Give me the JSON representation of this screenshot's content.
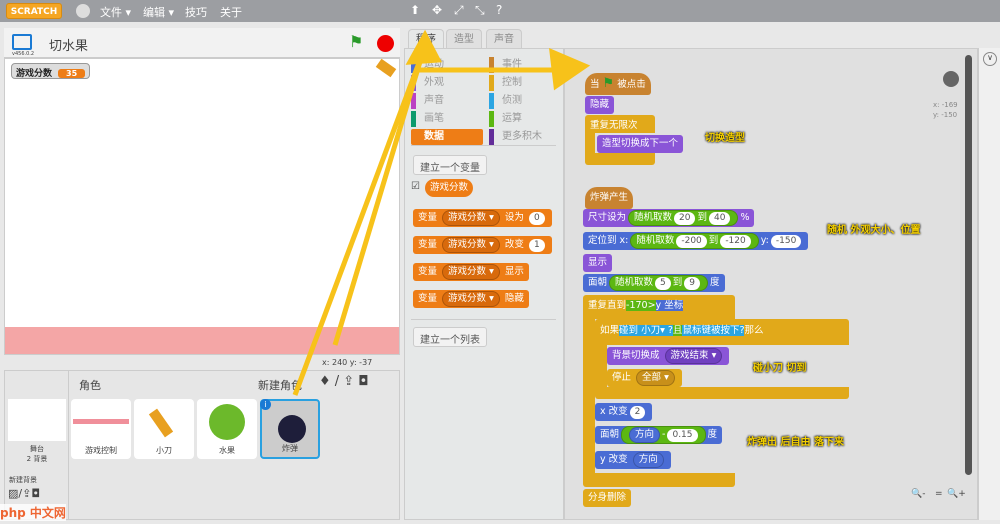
{
  "topbar": {
    "logo": "SCRATCH",
    "menus": [
      "文件 ▾",
      "编辑 ▾",
      "技巧",
      "关于"
    ],
    "tools": [
      "⬆",
      "✥",
      "⤢",
      "⤡",
      "?"
    ]
  },
  "stage": {
    "title": "切水果",
    "version": "v456.0.2",
    "monitor_label": "游戏分数",
    "monitor_value": "35",
    "coords": "x: 240  y: -37"
  },
  "sprites": {
    "header": "角色",
    "new_sprite": "新建角色",
    "stage_label": "舞台",
    "stage_sub": "2 背景",
    "new_backdrop": "新建背景",
    "items": [
      {
        "name": "游戏控制"
      },
      {
        "name": "小刀"
      },
      {
        "name": "水果"
      },
      {
        "name": "炸弹",
        "selected": true
      }
    ]
  },
  "tabs": [
    "程序",
    "造型",
    "声音"
  ],
  "palette": {
    "categories": [
      {
        "label": "运动",
        "color": "#4a6cd4"
      },
      {
        "label": "事件",
        "color": "#c88330"
      },
      {
        "label": "外观",
        "color": "#8a55d7"
      },
      {
        "label": "控制",
        "color": "#e1a91a"
      },
      {
        "label": "声音",
        "color": "#bb42c3"
      },
      {
        "label": "侦测",
        "color": "#2ca5e2"
      },
      {
        "label": "画笔",
        "color": "#0e9a6c"
      },
      {
        "label": "运算",
        "color": "#5cb712"
      },
      {
        "label": "数据",
        "color": "#ee7d16"
      },
      {
        "label": "更多积木",
        "color": "#632d99"
      }
    ],
    "make_variable": "建立一个变量",
    "variable": "游戏分数",
    "make_list": "建立一个列表",
    "blocks": [
      {
        "a": "变量",
        "v": "游戏分数",
        "b": "设为",
        "n": "0"
      },
      {
        "a": "变量",
        "v": "游戏分数",
        "b": "改变",
        "n": "1"
      },
      {
        "a": "变量",
        "v": "游戏分数",
        "b": "显示"
      },
      {
        "a": "变量",
        "v": "游戏分数",
        "b": "隐藏"
      }
    ]
  },
  "script": {
    "when": "当",
    "clicked": "被点击",
    "hide": "隐藏",
    "forever": "重复无限次",
    "next_costume": "造型切换成下一个",
    "receive": "炸弹产生",
    "size": "尺寸设为",
    "random": "随机取数",
    "to": "到",
    "s1": "20",
    "s2": "40",
    "pct": "%",
    "goto": "定位到 x:",
    "x1": "-200",
    "x2": "-120",
    "y": "y:",
    "y1": "-150",
    "show": "显示",
    "turn": "面朝",
    "d1": "5",
    "d2": "9",
    "deg": "度",
    "repeat_until": "重复直到",
    "ru_val": "-170",
    ">": ">",
    "ypos": "y 坐标",
    "if": "如果",
    "touching": "碰到",
    "knife": "小刀",
    "q": "?",
    "and": "且",
    "mouse": "鼠标键被按下?",
    "then": "那么",
    "switch_bg": "背景切换成",
    "bg_name": "游戏结束",
    "stop": "停止",
    "all": "全部",
    "change_x": "x 改变",
    "cx": "2",
    "turn2": "面朝",
    "dir": "方向",
    "minus": "-",
    "dv": "0.15",
    "change_y": "y 改变",
    "dir2": "方向",
    "delete": "分身删除"
  },
  "notes": [
    "切换造型",
    "随机 外观大小、位置",
    "碰小刀 切到",
    "炸弹出 后自由 落下来"
  ],
  "sprite_info": {
    "x": "x: -169",
    "y": "y: -150"
  },
  "zoom": [
    "🔍-",
    "=",
    "🔍+"
  ],
  "watermark": "php 中文网"
}
